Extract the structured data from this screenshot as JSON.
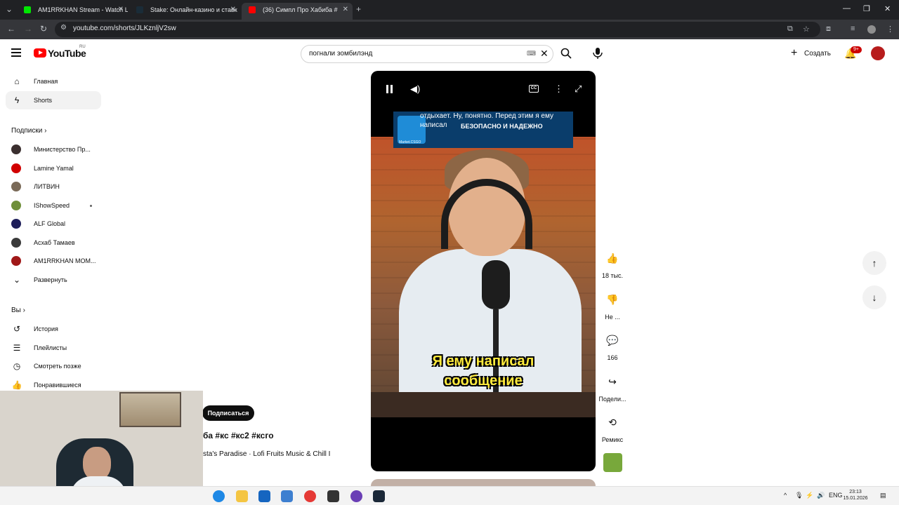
{
  "browser": {
    "tabs": [
      {
        "title": "AM1RRKHAN Stream - Watch L",
        "favicon_color": "#00e701"
      },
      {
        "title": "Stake: Онлайн-казино и ставк",
        "favicon_color": "#1a2c38"
      },
      {
        "title": "(36) Симпл Про Хабиба #",
        "favicon_color": "#ff0000"
      }
    ],
    "new_tab": "+",
    "url": "youtube.com/shorts/JLKznljV2sw"
  },
  "youtube": {
    "logo_text": "YouTube",
    "country": "RU",
    "search_query": "погнали зомбилэнд",
    "create_label": "Создать",
    "notif_badge": "9+"
  },
  "sidebar": {
    "home": "Главная",
    "shorts": "Shorts",
    "subscriptions_header": "Подписки",
    "channels": [
      {
        "name": "Министерство Пр...",
        "color": "#3b2f2f"
      },
      {
        "name": "Lamine Yamal",
        "color": "#d10000"
      },
      {
        "name": "ЛИТВИН",
        "color": "#7a6a58"
      },
      {
        "name": "IShowSpeed",
        "color": "#6f8f3a",
        "live_dot": true
      },
      {
        "name": "ALF Global",
        "color": "#1e1e5a"
      },
      {
        "name": "Асхаб Тамаев",
        "color": "#3a3a3a"
      },
      {
        "name": "AM1RRKHAN МОМ...",
        "color": "#a01818"
      }
    ],
    "expand": "Развернуть",
    "you_header": "Вы",
    "you_items": [
      "История",
      "Плейлисты",
      "Смотреть позже",
      "Понравившиеся"
    ]
  },
  "short": {
    "ad_caption": "отдыхает. Ну, понятно. Перед этим я ему написал",
    "ad_text": "БЕЗОПАСНО И НАДЕЖНО",
    "ad_brand": "Market.CSGO",
    "subtitle": "Я ему написал сообщение",
    "cc": "CC",
    "subscribe": "Подписаться",
    "title": "ба #кс #кс2 #ксго",
    "music": "sta's Paradise · Lofi Fruits Music & Chill I"
  },
  "actions": {
    "likes": "18 тыс.",
    "dislike": "Не ...",
    "comments": "166",
    "share": "Подели...",
    "remix": "Ремикс"
  },
  "taskbar": {
    "lang": "ENG",
    "time": "23:13",
    "date": "15.01.2026"
  }
}
